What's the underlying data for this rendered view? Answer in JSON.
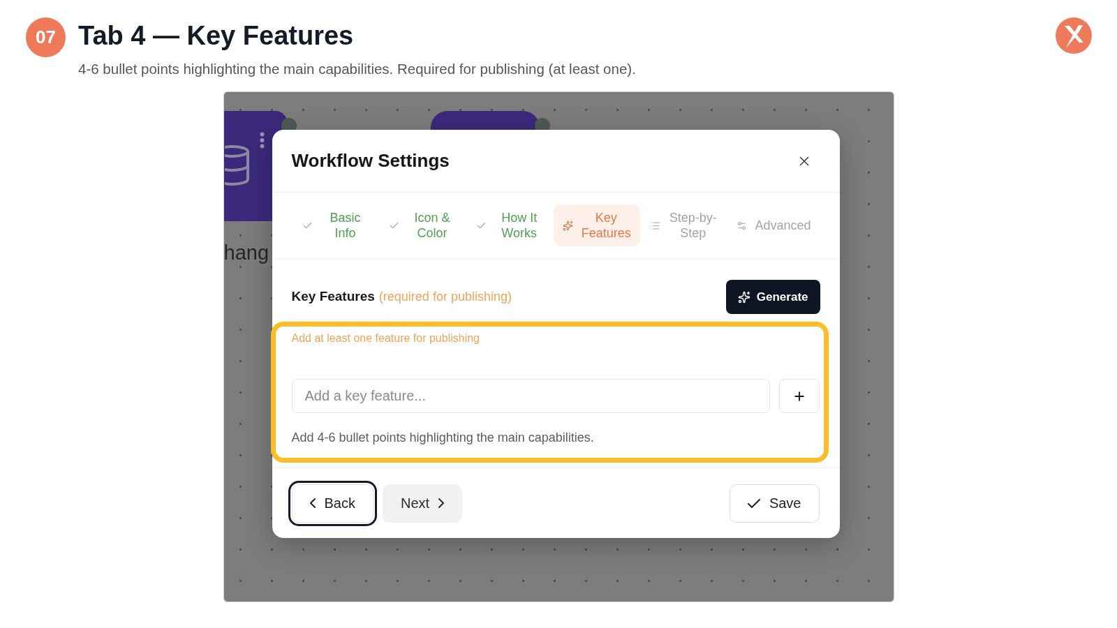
{
  "slide": {
    "number": "07",
    "title": "Tab 4 — Key Features",
    "subtitle": "4-6 bullet points highlighting the main capabilities. Required for publishing (at least one)."
  },
  "canvas": {
    "node_label": "hang"
  },
  "dialog": {
    "title": "Workflow Settings",
    "tabs": [
      {
        "label": "Basic Info",
        "selected": false,
        "completed": true
      },
      {
        "label": "Icon & Color",
        "selected": false,
        "completed": true
      },
      {
        "label": "How It Works",
        "selected": false,
        "completed": true
      },
      {
        "label": "Key Features",
        "selected": true,
        "completed": false
      },
      {
        "label": "Step-by-Step",
        "selected": false,
        "completed": false
      },
      {
        "label": "Advanced",
        "selected": false,
        "completed": false
      }
    ],
    "section": {
      "title": "Key Features",
      "note": "(required for publishing)",
      "generate_button": "Generate"
    },
    "warning": "Add at least one feature for publishing",
    "feature_input": {
      "placeholder": "Add a key feature..."
    },
    "hint": "Add 4-6 bullet points highlighting the main capabilities.",
    "footer_buttons": [
      {
        "label": "Back",
        "kind": "back",
        "focused": true
      },
      {
        "label": "Next",
        "kind": "next",
        "focused": false
      },
      {
        "label": "Save",
        "kind": "save",
        "focused": false
      }
    ]
  }
}
